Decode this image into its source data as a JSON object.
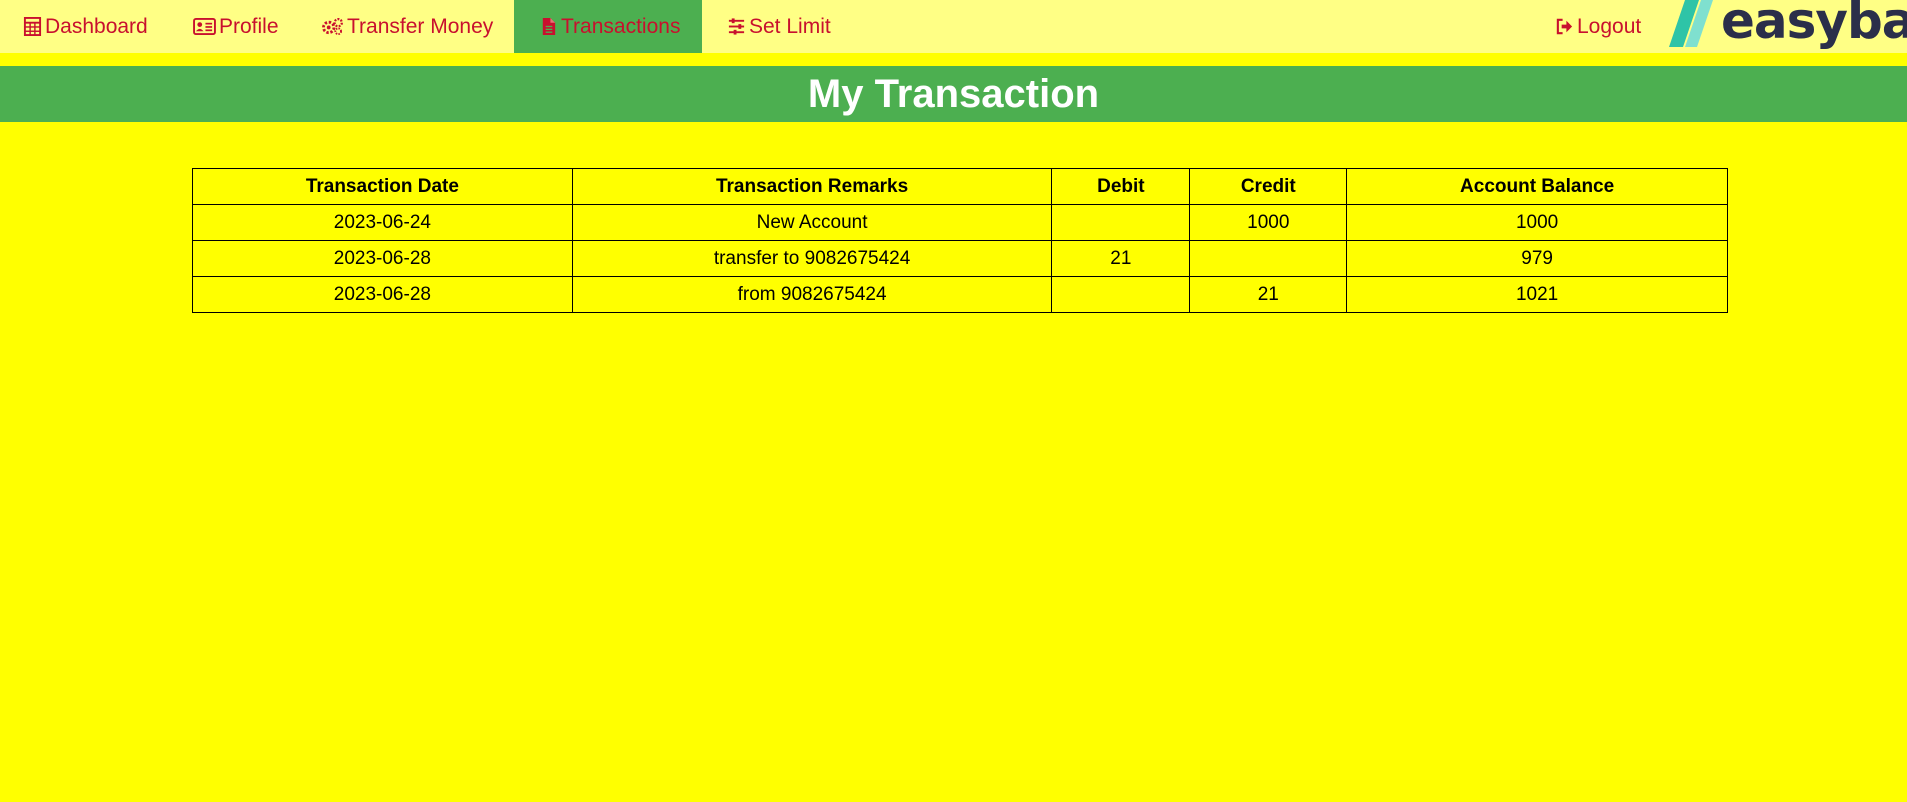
{
  "nav": {
    "items": [
      {
        "label": "Dashboard",
        "icon": "calculator-icon"
      },
      {
        "label": "Profile",
        "icon": "id-card-icon"
      },
      {
        "label": "Transfer Money",
        "icon": "gears-icon"
      },
      {
        "label": "Transactions",
        "icon": "file-icon",
        "active": true
      },
      {
        "label": "Set Limit",
        "icon": "sliders-icon"
      }
    ],
    "logout": {
      "label": "Logout",
      "icon": "sign-out-icon"
    },
    "logo_text": "easybank"
  },
  "page": {
    "title": "My Transaction"
  },
  "table": {
    "headers": [
      "Transaction Date",
      "Transaction Remarks",
      "Debit",
      "Credit",
      "Account Balance"
    ],
    "rows": [
      [
        "2023-06-24",
        "New Account",
        "",
        "1000",
        "1000"
      ],
      [
        "2023-06-28",
        "transfer to 9082675424",
        "21",
        "",
        "979"
      ],
      [
        "2023-06-28",
        "from 9082675424",
        "",
        "21",
        "1021"
      ]
    ]
  },
  "colors": {
    "page_bg": "#ffff00",
    "navbar_bg": "#ffff85",
    "accent_green": "#4caf50",
    "link_red": "#c8102e"
  }
}
